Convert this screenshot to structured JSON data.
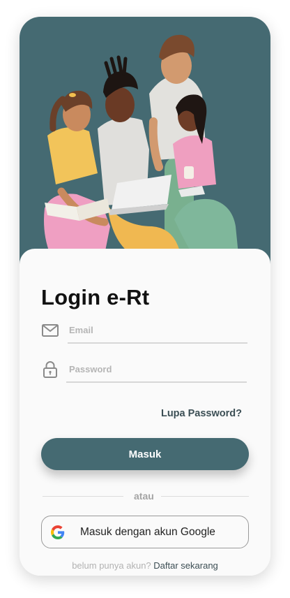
{
  "login": {
    "title": "Login e-Rt",
    "email_placeholder": "Email",
    "password_placeholder": "Password",
    "forgot_label": "Lupa Password?",
    "submit_label": "Masuk",
    "divider_label": "atau",
    "google_label": "Masuk dengan akun Google",
    "signup_prompt": "belum punya akun?",
    "signup_link": "Daftar sekarang"
  },
  "icons": {
    "email": "mail-icon",
    "password": "lock-icon",
    "google": "google-logo-icon"
  },
  "colors": {
    "primary": "#456a72",
    "hero_bg": "#456a72",
    "card_bg": "#fafafa",
    "link": "#3c4f55",
    "muted": "#b2b2b2"
  }
}
